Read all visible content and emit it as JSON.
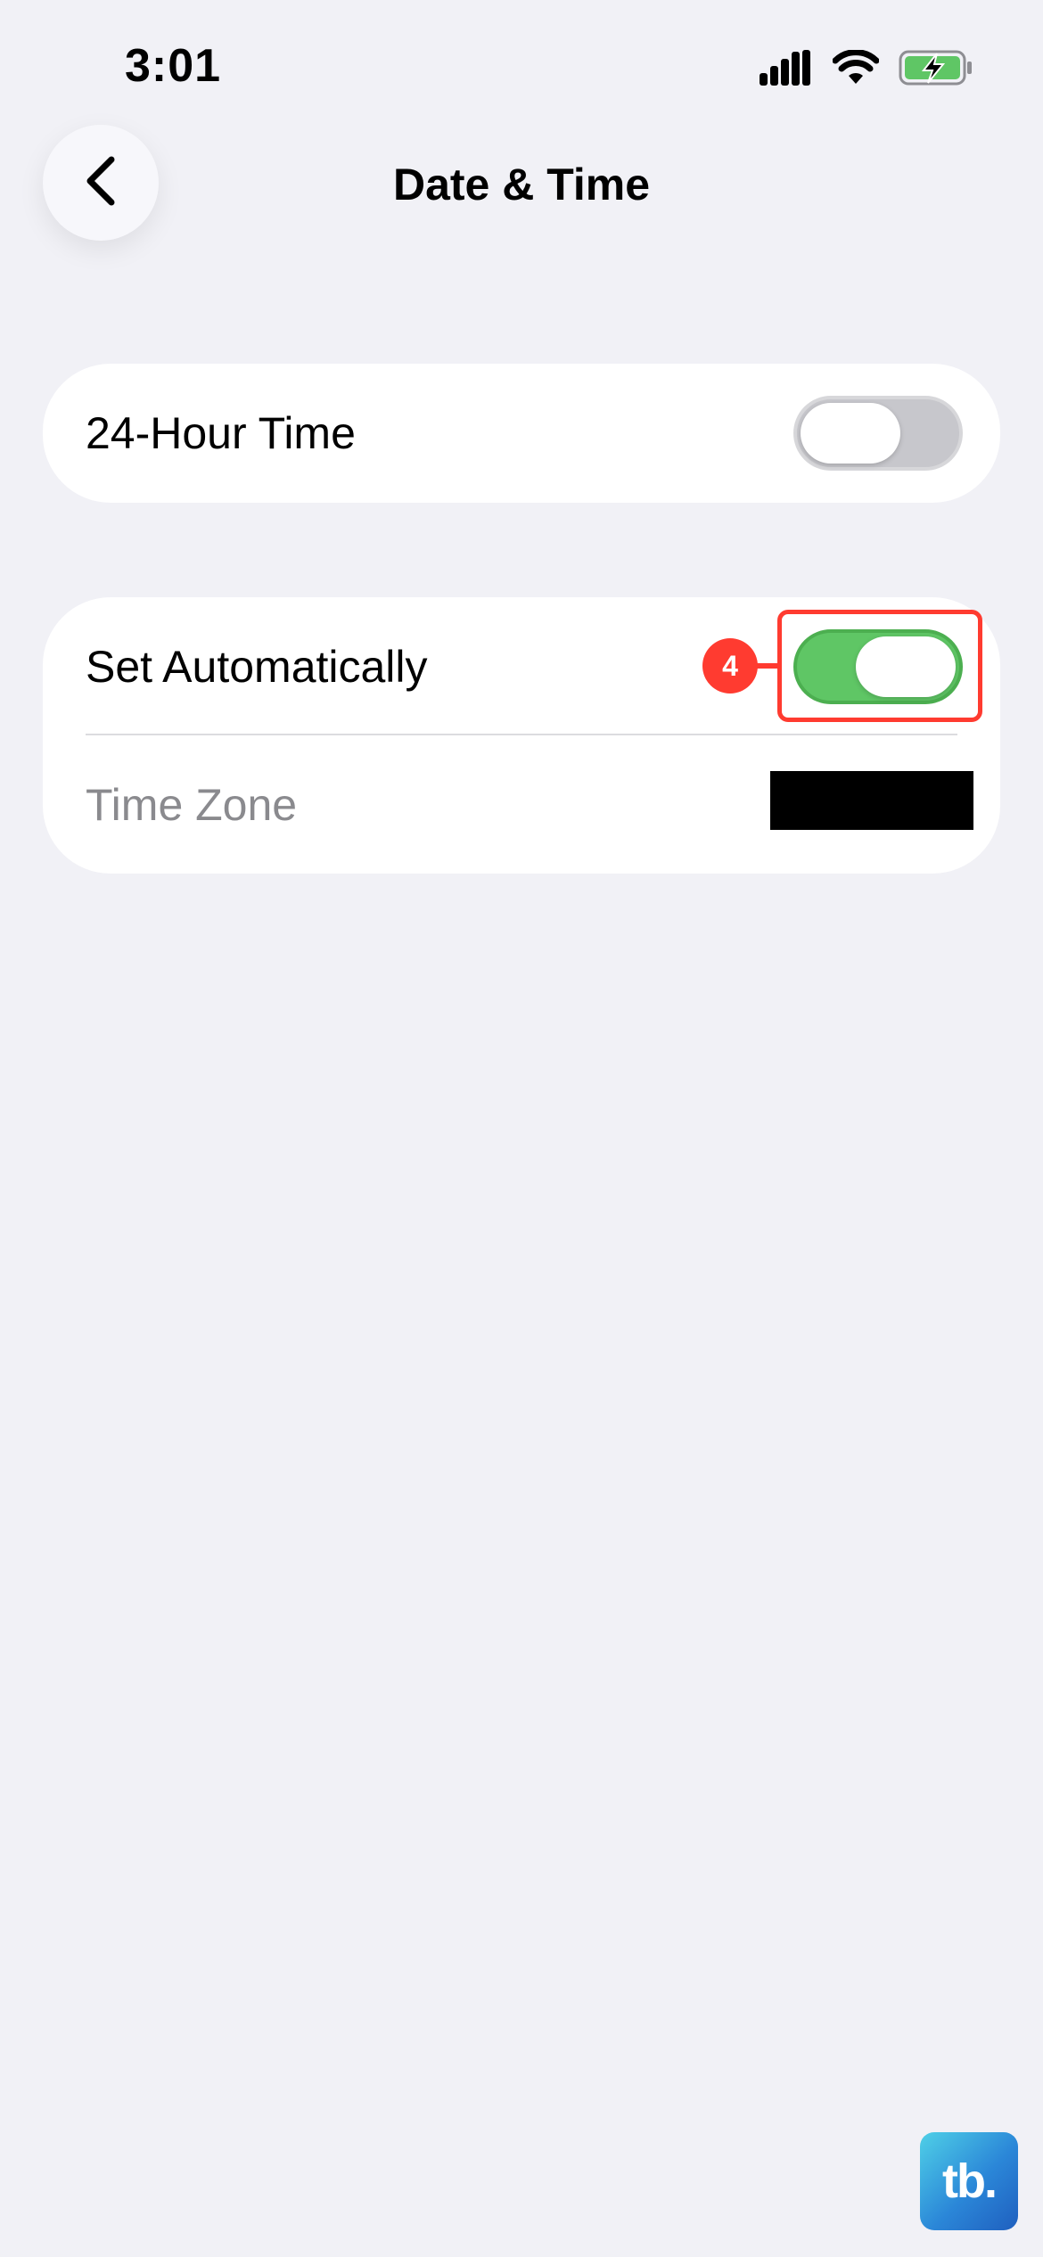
{
  "status_bar": {
    "time": "3:01",
    "icons": [
      "cellular-signal-icon",
      "wifi-icon",
      "battery-charging-icon"
    ]
  },
  "nav": {
    "back_icon": "chevron-left-icon",
    "title": "Date & Time"
  },
  "settings": {
    "hour24": {
      "label": "24-Hour Time",
      "enabled": false
    },
    "auto": {
      "label": "Set Automatically",
      "enabled": true
    },
    "timezone": {
      "label": "Time Zone",
      "value_redacted": true
    }
  },
  "annotation": {
    "step": "4",
    "color": "#ff3b30"
  },
  "watermark": {
    "text": "tb."
  },
  "colors": {
    "background": "#f1f1f6",
    "toggle_on": "#5fc665",
    "toggle_off": "#c7c7cc"
  }
}
